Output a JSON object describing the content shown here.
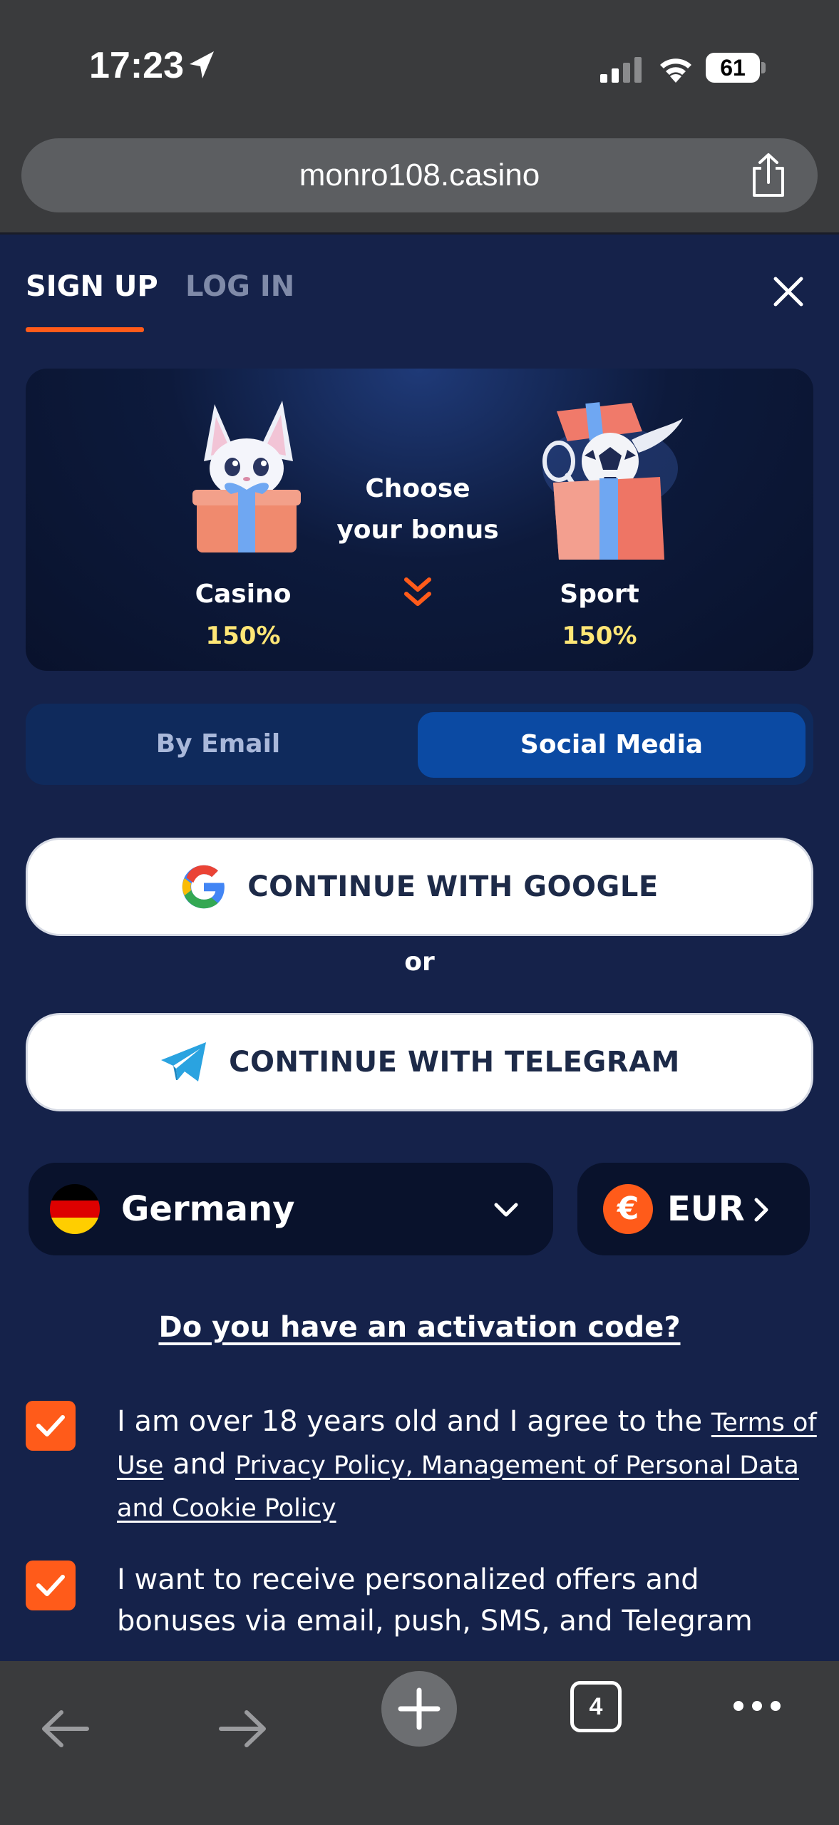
{
  "status_bar": {
    "time": "17:23",
    "battery": "61",
    "icons": [
      "location-arrow-icon",
      "cellular-signal-icon",
      "wifi-icon",
      "battery-icon"
    ]
  },
  "browser": {
    "url": "monro108.casino",
    "tab_count": "4",
    "icons": [
      "share-icon",
      "back-icon",
      "forward-icon",
      "new-tab-plus-icon",
      "tabs-icon",
      "more-icon"
    ]
  },
  "auth_tabs": {
    "signup": "SIGN UP",
    "login": "LOG IN",
    "active": "signup"
  },
  "bonus": {
    "prompt_line1": "Choose",
    "prompt_line2": "your bonus",
    "casino": {
      "label": "Casino",
      "percent": "150%"
    },
    "sport": {
      "label": "Sport",
      "percent": "150%"
    }
  },
  "method_tabs": {
    "email": "By Email",
    "social": "Social Media",
    "active": "social"
  },
  "social": {
    "google": "CONTINUE WITH GOOGLE",
    "or": "or",
    "telegram": "CONTINUE WITH TELEGRAM"
  },
  "region": {
    "country": "Germany",
    "currency_symbol": "€",
    "currency": "EUR"
  },
  "activation_link": "Do you have an activation code?",
  "consents": {
    "age": {
      "checked": true,
      "text_before": "I am over 18 years old and I agree to the ",
      "terms_link": "Terms of Use",
      "and": " and ",
      "privacy_link": "Privacy Policy, Management of Personal Data and Cookie Policy"
    },
    "marketing": {
      "checked": true,
      "text": "I want to receive personalized offers and bonuses via email, push, SMS, and Telegram"
    }
  },
  "colors": {
    "modal_bg": "#15224a",
    "accent": "#ff5b1a",
    "bonus_percent": "#ffe676",
    "active_segment": "#0b4aa3",
    "browser_chrome": "#3a3b3d"
  }
}
